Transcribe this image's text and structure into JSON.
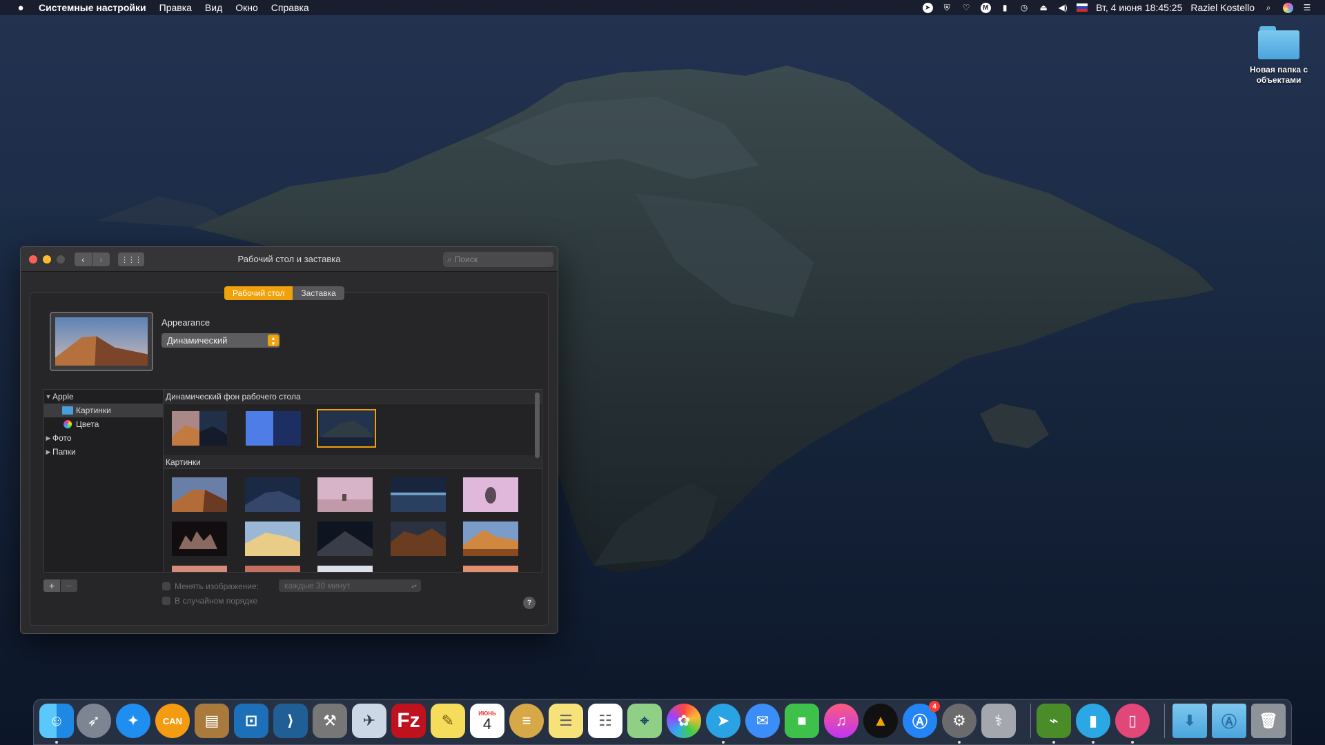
{
  "menubar": {
    "app_name": "Системные настройки",
    "items": [
      "Правка",
      "Вид",
      "Окно",
      "Справка"
    ],
    "datetime": "Вт, 4 июня  18:45:25",
    "user": "Raziel Kostello",
    "status_icons": [
      "telegram-icon",
      "shield-check-icon",
      "shield-icon",
      "m-circle-icon",
      "battery-icon",
      "time-machine-icon",
      "eject-icon",
      "volume-icon",
      "flag-ru-icon",
      "search-icon",
      "siri-icon",
      "list-icon"
    ]
  },
  "desktop": {
    "folder_label": "Новая папка с объектами"
  },
  "window": {
    "title": "Рабочий стол и заставка",
    "search_placeholder": "Поиск",
    "tabs": [
      {
        "label": "Рабочий стол",
        "active": true
      },
      {
        "label": "Заставка",
        "active": false
      }
    ],
    "appearance_label": "Appearance",
    "appearance_value": "Динамический",
    "sidebar": {
      "items": [
        {
          "label": "Apple",
          "expanded": true
        },
        {
          "label": "Картинки",
          "selected": true
        },
        {
          "label": "Цвета"
        },
        {
          "label": "Фото",
          "expanded": false
        },
        {
          "label": "Папки",
          "expanded": false
        }
      ]
    },
    "sections": {
      "dynamic": "Динамический фон рабочего стола",
      "pictures": "Картинки"
    },
    "change_picture_label": "Менять изображение:",
    "interval_value": "каждые 30 минут",
    "random_order_label": "В случайном порядке",
    "add_label": "+",
    "remove_label": "−",
    "help_label": "?"
  },
  "dock": {
    "apps": [
      {
        "name": "Finder",
        "icon": "finder-icon",
        "running": true
      },
      {
        "name": "Launchpad",
        "icon": "rocket-icon"
      },
      {
        "name": "Safari",
        "icon": "compass-icon"
      },
      {
        "name": "Can",
        "icon": "can-icon"
      },
      {
        "name": "Contacts",
        "icon": "contacts-icon"
      },
      {
        "name": "Sourcetree",
        "icon": "bracket-icon"
      },
      {
        "name": "VS Code",
        "icon": "code-icon"
      },
      {
        "name": "Migration",
        "icon": "tool-icon"
      },
      {
        "name": "Preview",
        "icon": "preview-icon"
      },
      {
        "name": "FileZilla",
        "icon": "filezilla-icon"
      },
      {
        "name": "Stickies",
        "icon": "sticky-icon"
      },
      {
        "name": "Calendar",
        "icon": "calendar-icon",
        "month": "ИЮНЬ",
        "day": "4"
      },
      {
        "name": "Sequel",
        "icon": "database-icon"
      },
      {
        "name": "Notes",
        "icon": "notes-icon"
      },
      {
        "name": "Reminders",
        "icon": "reminders-icon"
      },
      {
        "name": "Maps",
        "icon": "maps-icon"
      },
      {
        "name": "Photos",
        "icon": "photos-icon"
      },
      {
        "name": "Telegram",
        "icon": "telegram-icon",
        "running": true
      },
      {
        "name": "Messages",
        "icon": "messages-icon"
      },
      {
        "name": "FaceTime",
        "icon": "facetime-icon"
      },
      {
        "name": "iTunes",
        "icon": "music-icon"
      },
      {
        "name": "Vectorize",
        "icon": "triangle-icon"
      },
      {
        "name": "App Store",
        "icon": "appstore-icon",
        "badge": "4"
      },
      {
        "name": "System Preferences",
        "icon": "gear-icon",
        "running": true
      },
      {
        "name": "Disk Utility",
        "icon": "disk-icon"
      },
      {
        "name": "Transmit",
        "icon": "usb-icon",
        "running": true
      },
      {
        "name": "Archiver",
        "icon": "zip-icon",
        "running": true
      },
      {
        "name": "Unarchiver",
        "icon": "zip-pink-icon",
        "running": true
      },
      {
        "name": "Downloads",
        "icon": "downloads-folder-icon"
      },
      {
        "name": "Applications",
        "icon": "apps-folder-icon"
      },
      {
        "name": "Trash",
        "icon": "trash-icon"
      }
    ]
  },
  "colors": {
    "accent": "#f0a20a",
    "window_bg": "#2b2b2d",
    "menubar_bg": "#161a26"
  }
}
